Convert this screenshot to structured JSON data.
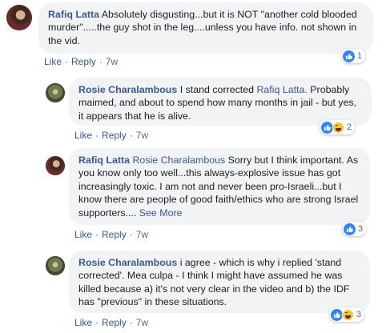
{
  "comments": [
    {
      "author": "Rafiq Latta",
      "text": "Absolutely disgusting...but it is NOT \"another cold blooded murder\".....the guy shot in the leg....unless you have info. not shown in the vid.",
      "like": "Like",
      "reply": "Reply",
      "time": "7w",
      "reaction_count": "1",
      "reactions": [
        "like-icon"
      ]
    },
    {
      "author": "Rosie Charalambous",
      "text": "I stand corrected",
      "tag": "Rafiq Latta.",
      "text_after": "Probably maimed, and about to spend how many months in jail - but yes, it appears that he is alive.",
      "like": "Like",
      "reply": "Reply",
      "time": "7w",
      "reaction_count": "2",
      "reactions": [
        "like-icon",
        "haha-icon"
      ]
    },
    {
      "author": "Rafiq Latta",
      "tag": "Rosie Charalambous",
      "text": "Sorry but I think important. As you know only too well...this always-explosive issue has got increasingly toxic. I am not and never been pro-Israeli...but I know there are people of good faith/ethics who are strong Israel supporters....",
      "see_more": "See More",
      "like": "Like",
      "reply": "Reply",
      "time": "7w",
      "reaction_count": "3",
      "reactions": [
        "like-icon"
      ]
    },
    {
      "author": "Rosie Charalambous",
      "text": "i agree - which is why i replied 'stand corrected'. Mea culpa - I think I might have assumed he was killed because a) it's not very clear in the video and b) the IDF has \"previous\" in these situations.",
      "like": "Like",
      "reply": "Reply",
      "time": "7w",
      "reaction_count": "3",
      "reactions": [
        "like-icon",
        "haha-icon"
      ]
    }
  ],
  "colors": {
    "link": "#385898",
    "bubble": "#f2f3f5",
    "meta": "#606770",
    "like_blue": "#2d86ff"
  }
}
